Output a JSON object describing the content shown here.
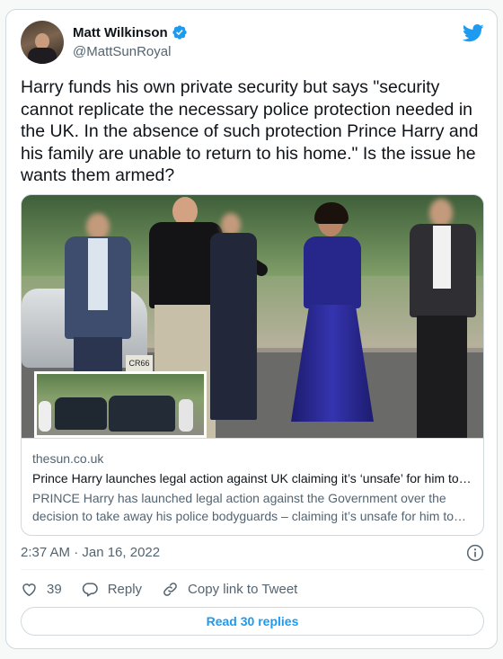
{
  "author": {
    "display_name": "Matt Wilkinson",
    "handle": "@MattSunRoyal",
    "verified": true,
    "avatar_icon": "profile-photo"
  },
  "brand": {
    "icon": "twitter-bird-icon",
    "color": "#1d9bf0"
  },
  "tweet": {
    "text": "Harry funds his own private security but says \"security cannot replicate the necessary police protection needed in the UK. In the absence of such protection Prince Harry and his family are unable to return to his home.\" Is the issue he wants them armed?"
  },
  "link_card": {
    "photo_plate_text": "CR66",
    "domain": "thesun.co.uk",
    "title": "Prince Harry launches legal action against UK claiming it’s ‘unsafe’ for him to return home",
    "description": "PRINCE Harry has launched legal action against the Government over the decision to take away his police bodyguards – claiming it’s unsafe for him to come home with his family."
  },
  "meta": {
    "timestamp": "2:37 AM · Jan 16, 2022"
  },
  "actions": {
    "like_count": "39",
    "reply_label": "Reply",
    "copy_link_label": "Copy link to Tweet"
  },
  "footer": {
    "read_replies_label": "Read 30 replies"
  },
  "colors": {
    "text_primary": "#0f1419",
    "text_secondary": "#536471",
    "border": "#cfd9de",
    "accent": "#1d9bf0"
  }
}
